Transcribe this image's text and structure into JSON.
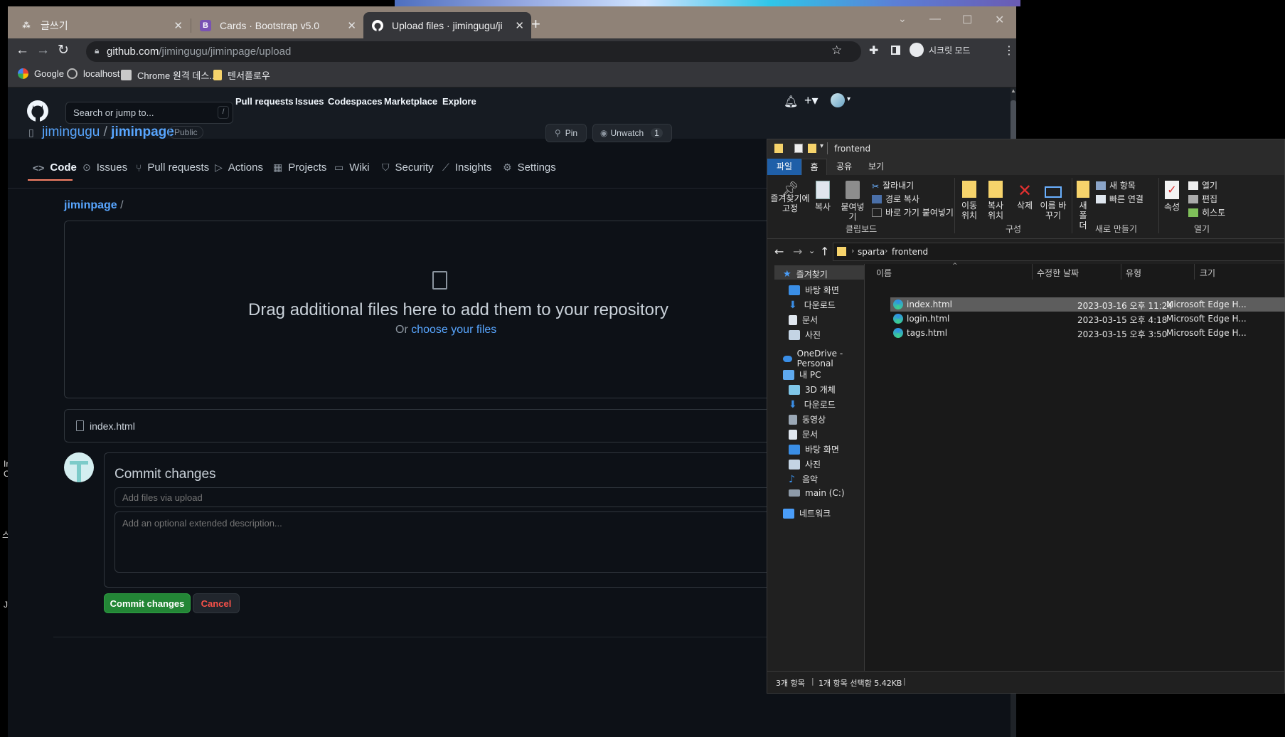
{
  "desktop_fragments": [
    "Ir",
    "C",
    "스",
    "Ja"
  ],
  "browser": {
    "tabs": [
      {
        "title": "글쓰기",
        "icon": "notion-icon"
      },
      {
        "title": "Cards · Bootstrap v5.0",
        "icon": "bootstrap-icon"
      },
      {
        "title": "Upload files · jimingugu/jiminpa",
        "icon": "github-icon"
      }
    ],
    "bootstrap_glyph": "B",
    "address": {
      "host": "github.com",
      "path": "/jimingugu/jiminpage/upload"
    },
    "profile_label": "시크릿 모드",
    "bookmarks": [
      "Google",
      "localhost",
      "Chrome 원격 데스...",
      "텐서플로우"
    ]
  },
  "github": {
    "search_placeholder": "Search or jump to...",
    "search_key": "/",
    "nav": [
      "Pull requests",
      "Issues",
      "Codespaces",
      "Marketplace",
      "Explore"
    ],
    "owner": "jimingugu",
    "separator": "/",
    "repo": "jiminpage",
    "visibility": "Public",
    "pin_label": "Pin",
    "unwatch_label": "Unwatch",
    "watch_count": "1",
    "repo_tabs": [
      "Code",
      "Issues",
      "Pull requests",
      "Actions",
      "Projects",
      "Wiki",
      "Security",
      "Insights",
      "Settings"
    ],
    "breadcrumb_repo": "jiminpage",
    "breadcrumb_sep": "/",
    "drop_title": "Drag additional files here to add them to your repository",
    "drop_or": "Or",
    "drop_link": "choose your files",
    "uploaded_file": "index.html",
    "commit_title": "Commit changes",
    "commit_summary_placeholder": "Add files via upload",
    "commit_desc_placeholder": "Add an optional extended description...",
    "commit_button": "Commit changes",
    "cancel_button": "Cancel"
  },
  "explorer": {
    "title": "frontend",
    "ribbon_tabs": [
      "파일",
      "홈",
      "공유",
      "보기"
    ],
    "ribbon": {
      "pin_label": "즐겨찾기에 고정",
      "copy": "복사",
      "paste": "붙여넣기",
      "cut": "잘라내기",
      "copy_path": "경로 복사",
      "paste_shortcut": "바로 가기 붙여넣기",
      "group_clipboard": "클립보드",
      "move_to": "이동 위치",
      "copy_to": "복사 위치",
      "delete": "삭제",
      "rename": "이름 바꾸기",
      "group_organize": "구성",
      "new_folder": "새 폴더",
      "new_item": "새 항목",
      "easy_access": "빠른 연결",
      "group_new": "새로 만들기",
      "properties": "속성",
      "open": "열기",
      "edit": "편집",
      "history": "히스토",
      "group_open": "열기"
    },
    "path": [
      "sparta",
      "frontend"
    ],
    "nav": {
      "quick_access": "즐겨찾기",
      "quick_items": [
        "바탕 화면",
        "다운로드",
        "문서",
        "사진"
      ],
      "onedrive": "OneDrive - Personal",
      "this_pc": "내 PC",
      "pc_items": [
        "3D 개체",
        "다운로드",
        "동영상",
        "문서",
        "바탕 화면",
        "사진",
        "음악",
        "main (C:)"
      ],
      "network": "네트워크"
    },
    "columns": [
      "이름",
      "수정한 날짜",
      "유형",
      "크기"
    ],
    "files": [
      {
        "name": "index.html",
        "date": "2023-03-16 오후 11:24",
        "type": "Microsoft Edge H...",
        "selected": true
      },
      {
        "name": "login.html",
        "date": "2023-03-15 오후 4:18",
        "type": "Microsoft Edge H...",
        "selected": false
      },
      {
        "name": "tags.html",
        "date": "2023-03-15 오후 3:50",
        "type": "Microsoft Edge H...",
        "selected": false
      }
    ],
    "status_count": "3개 항목",
    "status_selected": "1개 항목 선택함 5.42KB"
  }
}
